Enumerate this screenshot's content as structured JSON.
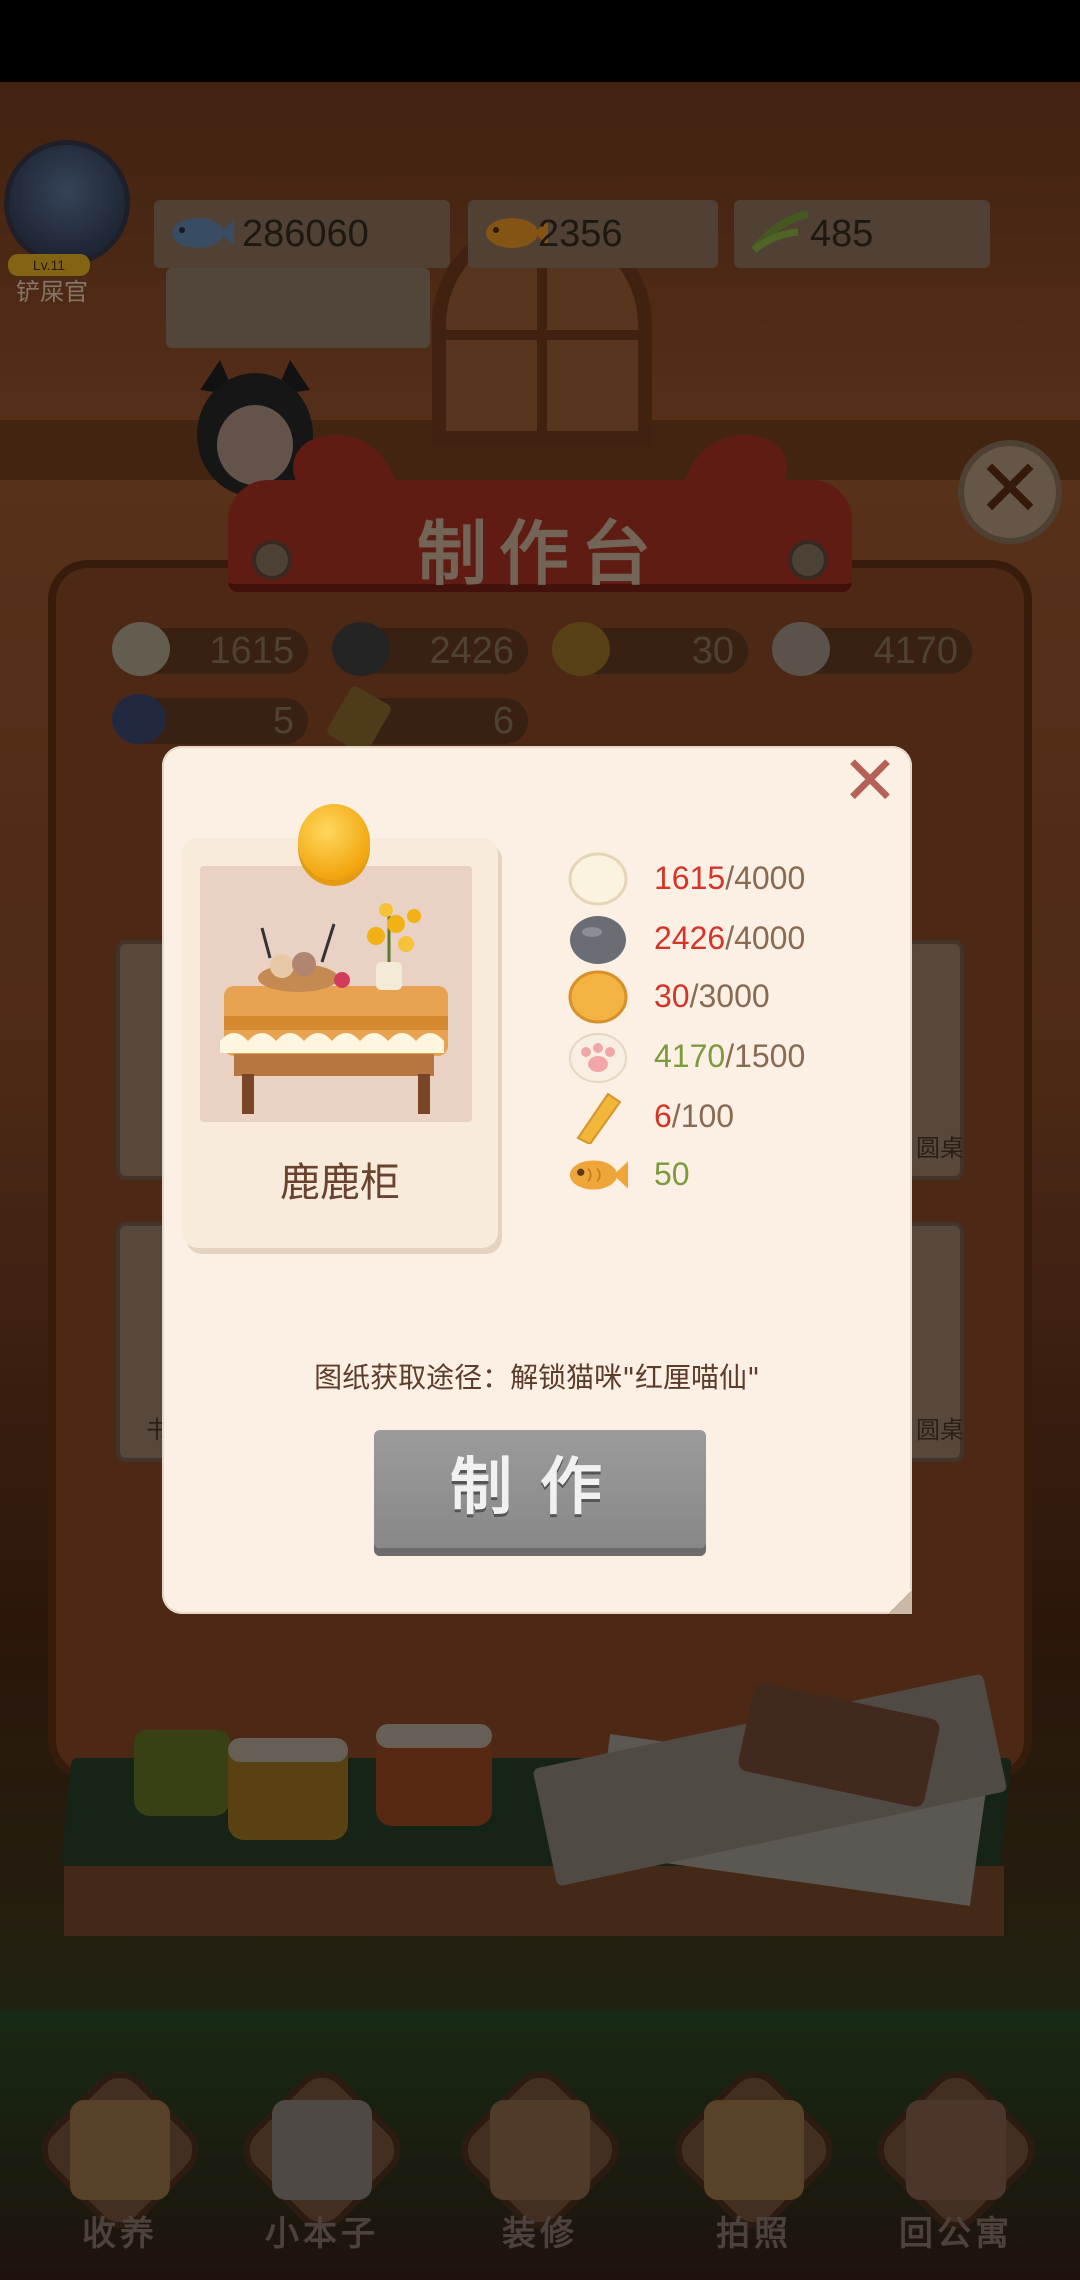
{
  "player": {
    "name": "铲屎官",
    "level_badge": "Lv.11"
  },
  "currencies": [
    {
      "icon": "fish-icon",
      "value": "286060"
    },
    {
      "icon": "gold-fish-icon",
      "value": "2356"
    },
    {
      "icon": "grass-icon",
      "value": "485"
    }
  ],
  "workbench": {
    "title": "制作台",
    "materials": [
      {
        "icon": "cotton-ball-icon",
        "value": "1615",
        "color": "#e8dcc0"
      },
      {
        "icon": "stone-icon",
        "value": "2426",
        "color": "#5a5a5a"
      },
      {
        "icon": "dough-ball-icon",
        "value": "30",
        "color": "#c98f25"
      },
      {
        "icon": "paw-icon",
        "value": "4170",
        "color": "#d8c6b4"
      },
      {
        "icon": "gear-icon",
        "value": "5",
        "color": "#4b5f9a"
      },
      {
        "icon": "gold-bar-icon",
        "value": "6",
        "color": "#c5972f"
      }
    ],
    "bg_cards": [
      "圆桌",
      "圆桌",
      "书"
    ]
  },
  "modal": {
    "item_name": "鹿鹿柜",
    "requirements": [
      {
        "icon": "cotton-ball-icon",
        "have": "1615",
        "need": "/4000",
        "status": "red"
      },
      {
        "icon": "stone-icon",
        "have": "2426",
        "need": "/4000",
        "status": "red"
      },
      {
        "icon": "dough-ball-icon",
        "have": "30",
        "need": "/3000",
        "status": "red"
      },
      {
        "icon": "paw-icon",
        "have": "4170",
        "need": "/1500",
        "status": "green"
      },
      {
        "icon": "gold-bar-icon",
        "have": "6",
        "need": "/100",
        "status": "red"
      },
      {
        "icon": "gold-fish-icon",
        "have": "50",
        "need": "",
        "status": "green"
      }
    ],
    "source_text": "图纸获取途径：解锁猫咪\"红厘喵仙\"",
    "make_button": "制作",
    "close": "✕"
  },
  "nav": [
    {
      "label": "收养",
      "icon": "box-icon"
    },
    {
      "label": "小本子",
      "icon": "notebook-icon"
    },
    {
      "label": "装修",
      "icon": "paint-icon"
    },
    {
      "label": "拍照",
      "icon": "camera-icon"
    },
    {
      "label": "回公寓",
      "icon": "apartment-icon"
    }
  ],
  "bg_close": "✕"
}
